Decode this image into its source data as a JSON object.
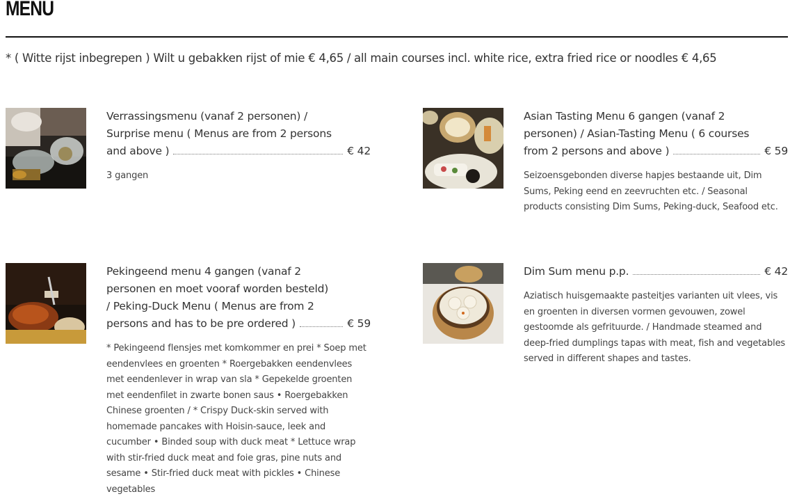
{
  "page": {
    "title": "MENU",
    "note": "* ( Witte rijst inbegrepen ) Wilt u gebakken rijst of mie € 4,65 / all main courses incl. white rice, extra fried rice or noodles € 4,65"
  },
  "items": [
    {
      "name_lines": [
        "Verrassingsmenu (vanaf 2 personen) /",
        "Surprise menu ( Menus are from 2 persons"
      ],
      "name_last": "and above )",
      "price": "€ 42",
      "description": "3 gangen",
      "image": "chef-plating-photo"
    },
    {
      "name_lines": [
        "Asian Tasting Menu 6 gangen (vanaf 2",
        "personen) / Asian-Tasting Menu ( 6 courses"
      ],
      "name_last": "from 2 persons and above )",
      "price": "€ 59",
      "description": "Seizoensgebonden diverse hapjes bestaande uit, Dim Sums, Peking eend en zeevruchten etc. / Seasonal products consisting Dim Sums, Peking-duck, Seafood etc.",
      "image": "tasting-platter-photo"
    },
    {
      "name_lines": [
        "Pekingeend menu 4 gangen (vanaf 2",
        "personen en moet vooraf worden besteld)",
        "/ Peking-Duck Menu ( Menus are from 2"
      ],
      "name_last": "persons and has to be pre ordered )",
      "price": "€ 59",
      "description": "* Pekingeend flensjes met komkommer en prei * Soep met eendenvlees en groenten * Roergebakken eendenvlees met eendenlever in wrap van sla * Gepekelde groenten met eendenfilet in zwarte bonen saus • Roergebakken Chinese groenten / * Crispy Duck-skin served with homemade pancakes with Hoisin-sauce, leek and cucumber • Binded soup with duck meat * Lettuce wrap with stir-fried duck meat and foie gras, pine nuts and sesame • Stir-fried duck meat with pickles • Chinese vegetables",
      "image": "peking-duck-photo"
    },
    {
      "name_lines": [],
      "name_last": "Dim Sum menu p.p.",
      "price": "€ 42",
      "description": "Aziatisch huisgemaakte pasteitjes varianten uit vlees, vis en groenten in diversen vormen gevouwen, zowel gestoomde als gefrituurde. / Handmade steamed and deep-fried dumplings tapas with meat, fish and vegetables served in different shapes and tastes.",
      "image": "dim-sum-basket-photo"
    }
  ]
}
